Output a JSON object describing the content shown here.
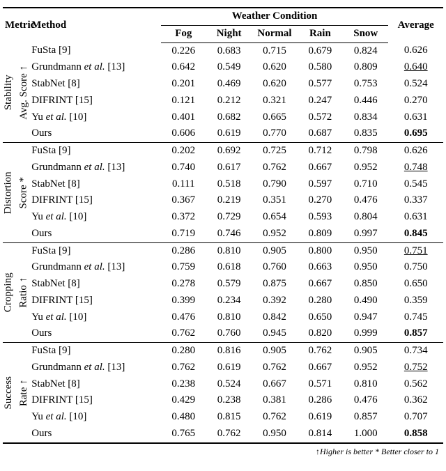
{
  "header": {
    "metric": "Metric",
    "method": "Method",
    "weather": "Weather Condition",
    "average": "Average",
    "cols": [
      "Fog",
      "Night",
      "Normal",
      "Rain",
      "Snow"
    ]
  },
  "footnote": "↑Higher is better * Better closer to 1",
  "methods": [
    "FuSta [9]",
    "Grundmann et al. [13]",
    "StabNet [8]",
    "DIFRINT [15]",
    "Yu et al. [10]",
    "Ours"
  ],
  "chart_data": {
    "type": "table",
    "metrics": [
      {
        "name": "Stability Avg. Score ↑",
        "label_lines": [
          "Stability",
          "Avg. Score ↑"
        ],
        "rows": [
          {
            "method": "FuSta [9]",
            "v": [
              "0.226",
              "0.683",
              "0.715",
              "0.679",
              "0.824"
            ],
            "avg": "0.626",
            "avg_style": ""
          },
          {
            "method": "Grundmann et al. [13]",
            "v": [
              "0.642",
              "0.549",
              "0.620",
              "0.580",
              "0.809"
            ],
            "avg": "0.640",
            "avg_style": "underline"
          },
          {
            "method": "StabNet [8]",
            "v": [
              "0.201",
              "0.469",
              "0.620",
              "0.577",
              "0.753"
            ],
            "avg": "0.524",
            "avg_style": ""
          },
          {
            "method": "DIFRINT [15]",
            "v": [
              "0.121",
              "0.212",
              "0.321",
              "0.247",
              "0.446"
            ],
            "avg": "0.270",
            "avg_style": ""
          },
          {
            "method": "Yu et al. [10]",
            "v": [
              "0.401",
              "0.682",
              "0.665",
              "0.572",
              "0.834"
            ],
            "avg": "0.631",
            "avg_style": ""
          },
          {
            "method": "Ours",
            "v": [
              "0.606",
              "0.619",
              "0.770",
              "0.687",
              "0.835"
            ],
            "avg": "0.695",
            "avg_style": "bold"
          }
        ]
      },
      {
        "name": "Distortion Score *",
        "label_lines": [
          "Distortion",
          "Score *"
        ],
        "rows": [
          {
            "method": "FuSta [9]",
            "v": [
              "0.202",
              "0.692",
              "0.725",
              "0.712",
              "0.798"
            ],
            "avg": "0.626",
            "avg_style": ""
          },
          {
            "method": "Grundmann et al. [13]",
            "v": [
              "0.740",
              "0.617",
              "0.762",
              "0.667",
              "0.952"
            ],
            "avg": "0.748",
            "avg_style": "underline"
          },
          {
            "method": "StabNet [8]",
            "v": [
              "0.111",
              "0.518",
              "0.790",
              "0.597",
              "0.710"
            ],
            "avg": "0.545",
            "avg_style": ""
          },
          {
            "method": "DIFRINT [15]",
            "v": [
              "0.367",
              "0.219",
              "0.351",
              "0.270",
              "0.476"
            ],
            "avg": "0.337",
            "avg_style": ""
          },
          {
            "method": "Yu et al. [10]",
            "v": [
              "0.372",
              "0.729",
              "0.654",
              "0.593",
              "0.804"
            ],
            "avg": "0.631",
            "avg_style": ""
          },
          {
            "method": "Ours",
            "v": [
              "0.719",
              "0.746",
              "0.952",
              "0.809",
              "0.997"
            ],
            "avg": "0.845",
            "avg_style": "bold"
          }
        ]
      },
      {
        "name": "Cropping Ratio ↑",
        "label_lines": [
          "Cropping",
          "Ratio ↑"
        ],
        "rows": [
          {
            "method": "FuSta [9]",
            "v": [
              "0.286",
              "0.810",
              "0.905",
              "0.800",
              "0.950"
            ],
            "avg": "0.751",
            "avg_style": "underline"
          },
          {
            "method": "Grundmann et al. [13]",
            "v": [
              "0.759",
              "0.618",
              "0.760",
              "0.663",
              "0.950"
            ],
            "avg": "0.750",
            "avg_style": ""
          },
          {
            "method": "StabNet [8]",
            "v": [
              "0.278",
              "0.579",
              "0.875",
              "0.667",
              "0.850"
            ],
            "avg": "0.650",
            "avg_style": ""
          },
          {
            "method": "DIFRINT [15]",
            "v": [
              "0.399",
              "0.234",
              "0.392",
              "0.280",
              "0.490"
            ],
            "avg": "0.359",
            "avg_style": ""
          },
          {
            "method": "Yu et al. [10]",
            "v": [
              "0.476",
              "0.810",
              "0.842",
              "0.650",
              "0.947"
            ],
            "avg": "0.745",
            "avg_style": ""
          },
          {
            "method": "Ours",
            "v": [
              "0.762",
              "0.760",
              "0.945",
              "0.820",
              "0.999"
            ],
            "avg": "0.857",
            "avg_style": "bold"
          }
        ]
      },
      {
        "name": "Success Rate ↑",
        "label_lines": [
          "Success",
          "Rate ↑"
        ],
        "rows": [
          {
            "method": "FuSta [9]",
            "v": [
              "0.280",
              "0.816",
              "0.905",
              "0.762",
              "0.905"
            ],
            "avg": "0.734",
            "avg_style": ""
          },
          {
            "method": "Grundmann et al. [13]",
            "v": [
              "0.762",
              "0.619",
              "0.762",
              "0.667",
              "0.952"
            ],
            "avg": "0.752",
            "avg_style": "underline"
          },
          {
            "method": "StabNet [8]",
            "v": [
              "0.238",
              "0.524",
              "0.667",
              "0.571",
              "0.810"
            ],
            "avg": "0.562",
            "avg_style": ""
          },
          {
            "method": "DIFRINT [15]",
            "v": [
              "0.429",
              "0.238",
              "0.381",
              "0.286",
              "0.476"
            ],
            "avg": "0.362",
            "avg_style": ""
          },
          {
            "method": "Yu et al. [10]",
            "v": [
              "0.480",
              "0.815",
              "0.762",
              "0.619",
              "0.857"
            ],
            "avg": "0.707",
            "avg_style": ""
          },
          {
            "method": "Ours",
            "v": [
              "0.765",
              "0.762",
              "0.950",
              "0.814",
              "1.000"
            ],
            "avg": "0.858",
            "avg_style": "bold"
          }
        ]
      }
    ]
  }
}
